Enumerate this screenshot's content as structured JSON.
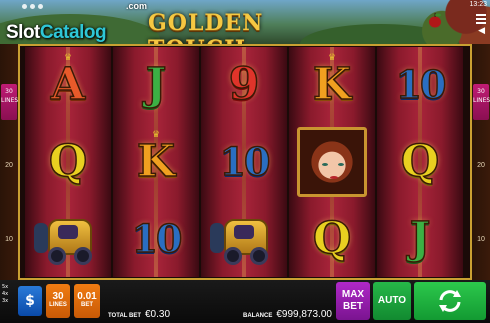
{
  "header": {
    "logo_part1": "Slot",
    "logo_part2": "Catalog",
    "logo_suffix": ".com",
    "game_title": "GOLDEN TOUCH",
    "clock": "13:23"
  },
  "paylines": {
    "left_top_value": "30",
    "left_top_unit": "LINES",
    "right_top_value": "30",
    "right_top_unit": "LINES",
    "left_mid": "20",
    "right_mid": "20",
    "left_bottom": "10",
    "right_bottom": "10"
  },
  "reels": [
    [
      "A",
      "Q",
      "coach"
    ],
    [
      "J",
      "K",
      "10"
    ],
    [
      "9",
      "10",
      "coach"
    ],
    [
      "K",
      "lady",
      "Q"
    ],
    [
      "10",
      "Q",
      "J"
    ]
  ],
  "footer": {
    "coin_options": [
      "5x",
      "4x",
      "3x"
    ],
    "currency_icon": "$",
    "lines_value": "30",
    "lines_label": "LINES",
    "bet_value": "0.01",
    "bet_label": "BET",
    "total_bet_label": "TOTAL BET",
    "total_bet_value": "€0.30",
    "balance_label": "BALANCE",
    "balance_value": "€999,873.00",
    "max_bet_line1": "MAX",
    "max_bet_line2": "BET",
    "auto_label": "AUTO",
    "spin_icon": "spin-arrows-icon"
  },
  "colors": {
    "title_gold": "#f5c842",
    "reel_red": "#a8243a",
    "line_tag": "#c01c74",
    "orange_button": "#f07c12",
    "max_bet": "#b028c8",
    "auto": "#26b848",
    "spin": "#2cc84c"
  }
}
